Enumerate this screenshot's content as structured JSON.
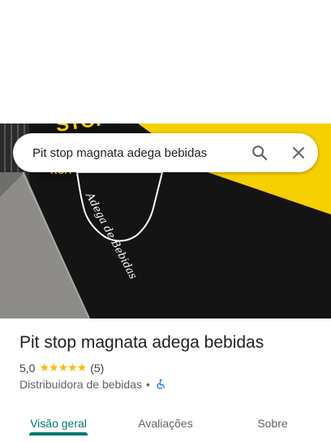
{
  "search": {
    "query": "Pit stop magnata adega bebidas",
    "search_icon": "search-icon",
    "clear_icon": "close-icon"
  },
  "photo": {
    "description_icon": "storefront-photo",
    "colors": {
      "wall": "#141414",
      "stripe": "#f5d000",
      "sidewalk": "#8a8a88"
    }
  },
  "place": {
    "title": "Pit stop magnata adega bebidas",
    "rating": "5,0",
    "stars": "★★★★★",
    "review_count": "(5)",
    "category": "Distribuidora de bebidas",
    "separator": "•",
    "accessibility_icon": "wheelchair-icon"
  },
  "tabs": [
    {
      "label": "Visão geral",
      "active": true
    },
    {
      "label": "Avaliações",
      "active": false
    },
    {
      "label": "Sobre",
      "active": false
    }
  ],
  "colors": {
    "accent": "#00796b",
    "star": "#fbbc04",
    "accessibility": "#1a73e8"
  }
}
